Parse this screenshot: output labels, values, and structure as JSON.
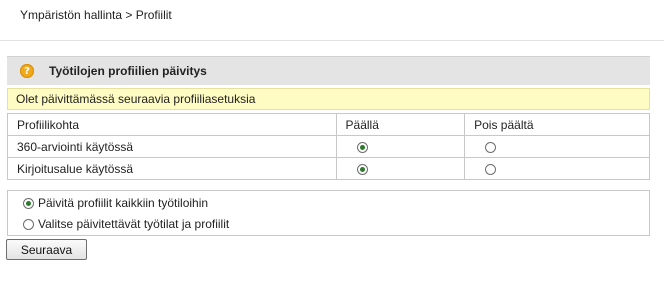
{
  "breadcrumb": "Ympäristön hallinta > Profiilit",
  "panel": {
    "title": "Työtilojen profiilien päivitys",
    "help_icon": "question-mark",
    "notice": "Olet päivittämässä seuraavia profiiliasetuksia"
  },
  "table": {
    "headers": [
      "Profiilikohta",
      "Päällä",
      "Pois päältä"
    ],
    "rows": [
      {
        "label": "360-arviointi käytössä",
        "on_selected": true
      },
      {
        "label": "Kirjoitusalue käytössä",
        "on_selected": true
      }
    ]
  },
  "apply": {
    "options": [
      {
        "label": "Päivitä profiilit kaikkiin työtiloihin",
        "selected": true
      },
      {
        "label": "Valitse päivitettävät työtilat ja profiilit",
        "selected": false
      }
    ]
  },
  "next_button": "Seuraava",
  "colors": {
    "header_bg": "#e4e4e4",
    "notice_bg": "#fefcc3",
    "help_icon": "#f0a81c",
    "radio_dot": "#2d7a2d"
  }
}
